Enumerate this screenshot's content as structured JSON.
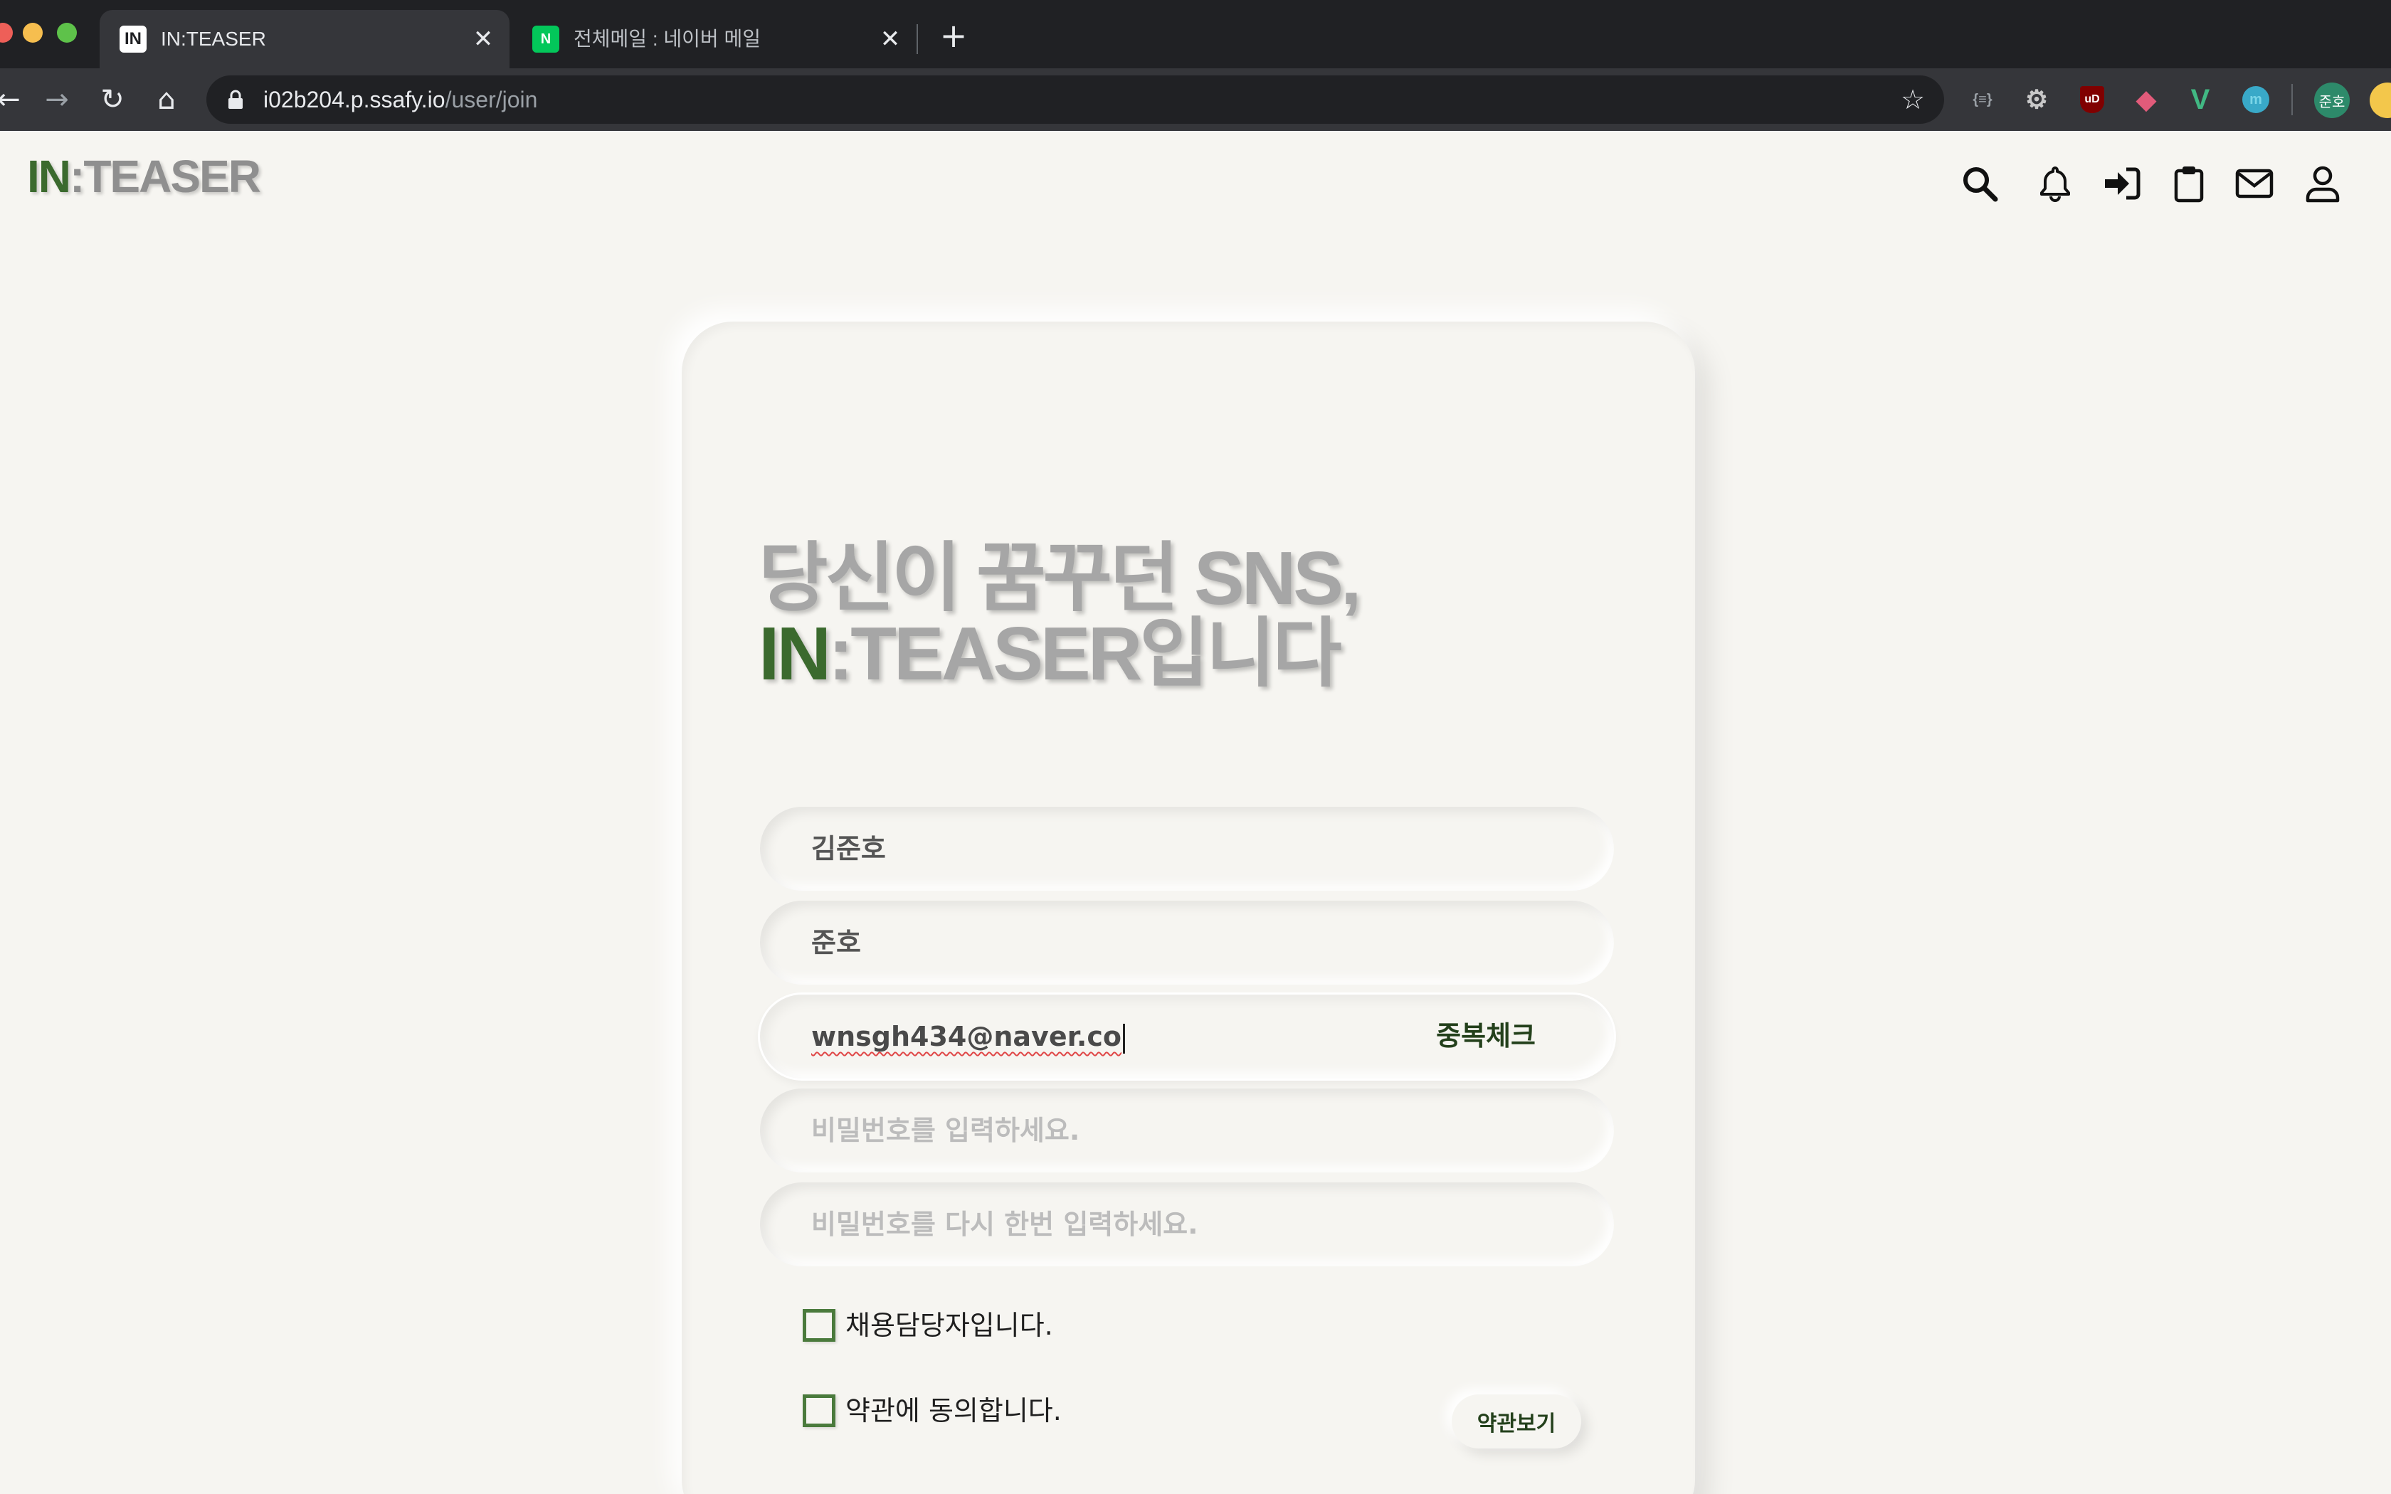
{
  "browser": {
    "tabs": [
      {
        "title": "IN:TEASER",
        "favicon": "IN",
        "active": true
      },
      {
        "title": "전체메일 : 네이버 메일",
        "favicon": "N",
        "active": false
      }
    ],
    "close_glyph": "✕",
    "new_tab_glyph": "+",
    "url_host": "i02b204.p.ssafy.io",
    "url_path": "/user/join",
    "nav": {
      "back": "←",
      "forward": "→",
      "reload": "↻",
      "home": "⌂"
    },
    "bookmark_glyph": "☆",
    "extensions": [
      "{≡}",
      "⚙",
      "uD",
      "◆",
      "V",
      "m"
    ],
    "profile_label": "준호"
  },
  "site": {
    "logo_in": "IN",
    "logo_rest": ":TEASER",
    "nav_icons": [
      "search-icon",
      "bell-icon",
      "sign-in-icon",
      "clipboard-icon",
      "envelope-icon",
      "user-icon"
    ]
  },
  "join_form": {
    "hero_line1": "당신이 꿈꾸던 SNS,",
    "hero_line2_in": "IN",
    "hero_line2_rest": ":TEASER입니다",
    "name_value": "김준호",
    "nickname_value": "준호",
    "email_value": "wnsgh434@naver.co",
    "duplicate_check_label": "중복체크",
    "password_placeholder": "비밀번호를 입력하세요.",
    "password_confirm_placeholder": "비밀번호를 다시 한번 입력하세요.",
    "recruiter_checkbox_label": "채용담당자입니다.",
    "terms_checkbox_label": "약관에 동의합니다.",
    "view_terms_label": "약관보기"
  },
  "colors": {
    "brand_green": "#3b6a2e",
    "page_bg": "#f6f5f1",
    "chrome_dark": "#202124"
  }
}
